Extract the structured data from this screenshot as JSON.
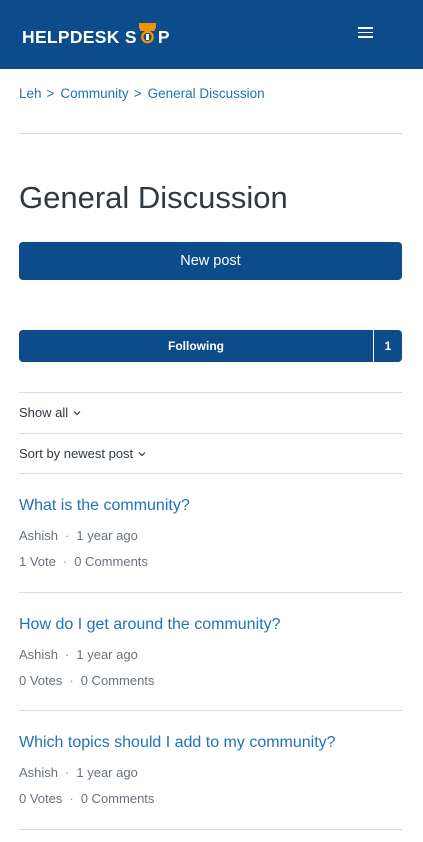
{
  "header": {
    "logo_text_left": "HELPDESK S",
    "logo_text_right": "P",
    "brand_color": "#0c4c8a",
    "logo_accent_color": "#f39200",
    "menu_icon": "hamburger-icon"
  },
  "breadcrumb": [
    "Leh",
    "Community",
    "General Discussion"
  ],
  "page_title": "General Discussion",
  "new_post_label": "New post",
  "following": {
    "label": "Following",
    "count": "1"
  },
  "filters": {
    "show": "Show all",
    "sort": "Sort by newest post"
  },
  "posts": [
    {
      "title": "What is the community?",
      "author": "Ashish",
      "time": "1 year ago",
      "votes": "1 Vote",
      "comments": "0 Comments"
    },
    {
      "title": "How do I get around the community?",
      "author": "Ashish",
      "time": "1 year ago",
      "votes": "0 Votes",
      "comments": "0 Comments"
    },
    {
      "title": "Which topics should I add to my community?",
      "author": "Ashish",
      "time": "1 year ago",
      "votes": "0 Votes",
      "comments": "0 Comments"
    }
  ]
}
